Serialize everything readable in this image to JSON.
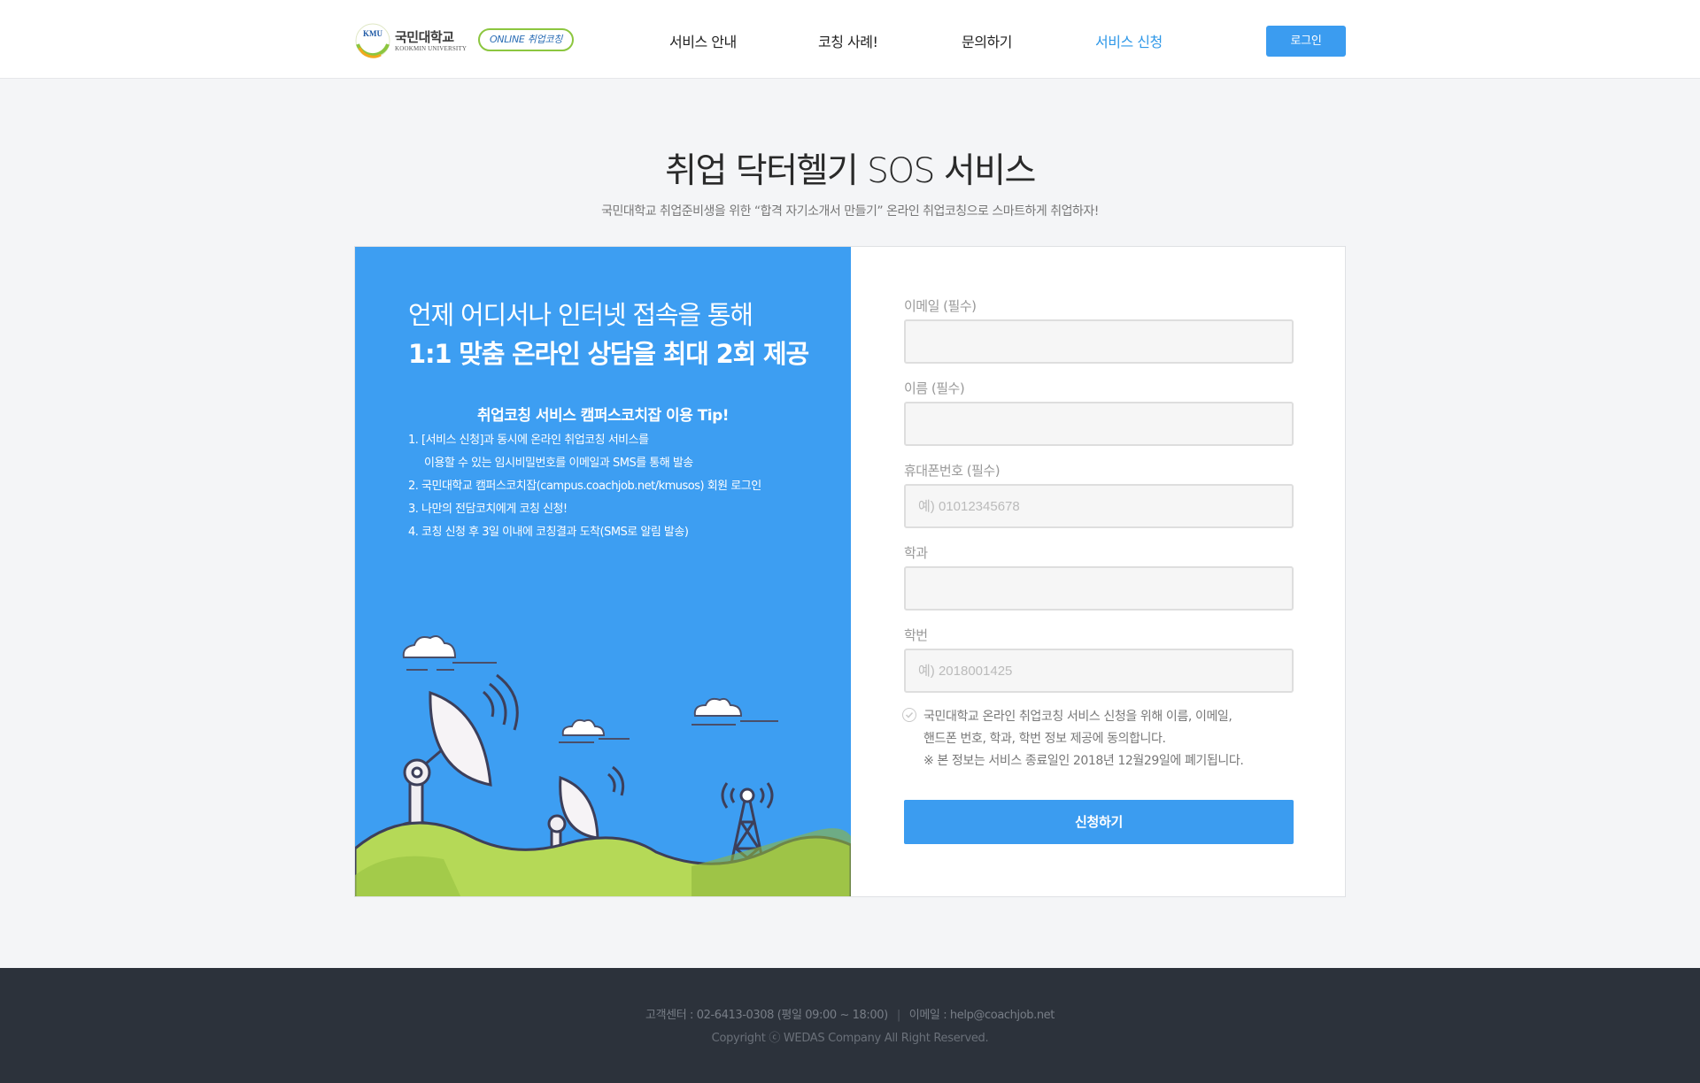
{
  "header": {
    "logo": {
      "emblem_text": "KMU",
      "name_kr": "국민대학교",
      "name_en": "KOOKMIN UNIVERSITY",
      "badge": "ONLINE 취업코칭"
    },
    "nav": [
      {
        "label": "서비스 안내"
      },
      {
        "label": "코칭 사례!"
      },
      {
        "label": "문의하기"
      },
      {
        "label": "서비스 신청",
        "active": true
      }
    ],
    "login_label": "로그인"
  },
  "page": {
    "title": "취업 닥터헬기 SOS 서비스",
    "subtitle": "국민대학교 취업준비생을 위한 “합격 자기소개서 만들기” 온라인 취업코칭으로 스마트하게 취업하자!"
  },
  "promo": {
    "headline_1": "언제 어디서나 인터넷 접속을 통해",
    "headline_2": "1:1 맞춤 온라인 상담을 최대 2회 제공",
    "tip_title": "취업코칭 서비스 캠퍼스코치잡 이용 Tip!",
    "tips": [
      "1. [서비스 신청]과 동시에  온라인 취업코칭 서비스를",
      "이용할 수 있는 임시비밀번호를 이메일과 SMS를 통해 발송",
      "2. 국민대학교 캠퍼스코치잡(campus.coachjob.net/kmusos)  회원 로그인",
      "3. 나만의 전담코치에게 코칭 신청!",
      "4. 코칭 신청 후 3일 이내에 코칭결과 도착(SMS로 알림 발송)"
    ],
    "illustration": "satellite-dishes-on-hills"
  },
  "form": {
    "fields": [
      {
        "label": "이메일 (필수)",
        "value": "",
        "placeholder": ""
      },
      {
        "label": "이름 (필수)",
        "value": "",
        "placeholder": ""
      },
      {
        "label": "휴대폰번호 (필수)",
        "value": "",
        "placeholder": "예) 01012345678"
      },
      {
        "label": "학과",
        "value": "",
        "placeholder": ""
      },
      {
        "label": "학번",
        "value": "",
        "placeholder": "예) 2018001425"
      }
    ],
    "agree_lines": [
      "국민대학교 온라인 취업코칭 서비스 신청을 위해 이름, 이메일,",
      "핸드폰 번호, 학과, 학번 정보 제공에 동의합니다.",
      "※ 본 정보는 서비스 종료일인 2018년 12월29일에 폐기됩니다."
    ],
    "agree_checked": false,
    "submit_label": "신청하기"
  },
  "footer": {
    "contact": "고객센터 : 02-6413-0308 (평일 09:00 ~ 18:00)",
    "separator": "|",
    "email": "이메일 : help@coachjob.net",
    "copyright": "Copyright ⓒ WEDAS Company All Right Reserved."
  },
  "colors": {
    "accent": "#3b9cf0",
    "promo_bg": "#3d9ef2",
    "footer_bg": "#2c323b",
    "hill": "#b5d957"
  }
}
